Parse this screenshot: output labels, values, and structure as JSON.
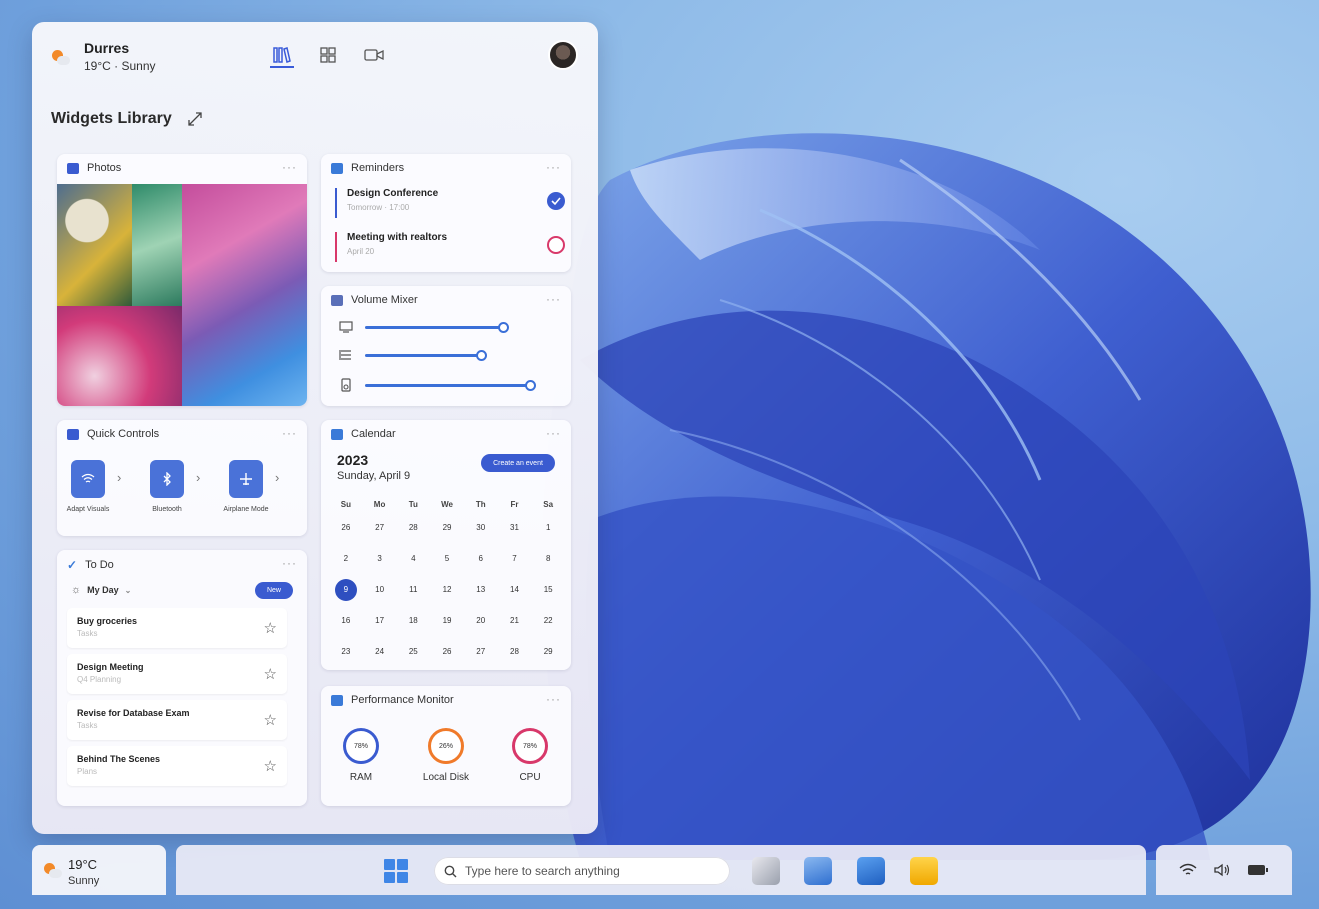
{
  "header": {
    "city": "Durres",
    "weather": "19°C · Sunny",
    "tabs": [
      "widgets-library",
      "widgets-grid",
      "media"
    ]
  },
  "library": {
    "title": "Widgets Library"
  },
  "photos": {
    "title": "Photos",
    "more": "···"
  },
  "reminders": {
    "title": "Reminders",
    "more": "···",
    "items": [
      {
        "title": "Design Conference",
        "sub": "Tomorrow · 17:00",
        "done": true,
        "color": "#3a5bd0"
      },
      {
        "title": "Meeting with realtors",
        "sub": "April 20",
        "done": false,
        "color": "#d8386a"
      }
    ]
  },
  "volume": {
    "title": "Volume Mixer",
    "more": "···",
    "levels": [
      0.77,
      0.65,
      0.92
    ],
    "icons": [
      "monitor-icon",
      "list-icon",
      "speaker-icon"
    ]
  },
  "quick_controls": {
    "title": "Quick Controls",
    "more": "···",
    "items": [
      {
        "label": "Adapt Visuals",
        "icon": "wifi-icon"
      },
      {
        "label": "Bluetooth",
        "icon": "bluetooth-icon"
      },
      {
        "label": "Airplane Mode",
        "icon": "airplane-icon"
      }
    ]
  },
  "calendar": {
    "title": "Calendar",
    "more": "···",
    "year": "2023",
    "date": "Sunday, April 9",
    "create_label": "Create an event",
    "weekdays": [
      "Su",
      "Mo",
      "Tu",
      "We",
      "Th",
      "Fr",
      "Sa"
    ],
    "weeks": [
      [
        "26",
        "27",
        "28",
        "29",
        "30",
        "31",
        "1"
      ],
      [
        "2",
        "3",
        "4",
        "5",
        "6",
        "7",
        "8"
      ],
      [
        "9",
        "10",
        "11",
        "12",
        "13",
        "14",
        "15"
      ],
      [
        "16",
        "17",
        "18",
        "19",
        "20",
        "21",
        "22"
      ],
      [
        "23",
        "24",
        "25",
        "26",
        "27",
        "28",
        "29"
      ]
    ],
    "selected": "9"
  },
  "todo": {
    "title": "To Do",
    "more": "···",
    "list": "My Day",
    "new_label": "New",
    "items": [
      {
        "title": "Buy groceries",
        "sub": "Tasks"
      },
      {
        "title": "Design Meeting",
        "sub": "Q4 Planning"
      },
      {
        "title": "Revise for Database Exam",
        "sub": "Tasks"
      },
      {
        "title": "Behind The Scenes",
        "sub": "Plans"
      }
    ]
  },
  "performance": {
    "title": "Performance Monitor",
    "more": "···",
    "items": [
      {
        "label": "RAM",
        "value": "78%",
        "color": "#3a5bd0"
      },
      {
        "label": "Local Disk",
        "value": "26%",
        "color": "#f07a2a"
      },
      {
        "label": "CPU",
        "value": "78%",
        "color": "#d8386a"
      }
    ]
  },
  "taskbar": {
    "temp": "19°C",
    "condition": "Sunny",
    "search_placeholder": "Type here to search anything"
  },
  "colors": {
    "accent": "#3a5bd0",
    "wallpaper": "#5e8fd3"
  }
}
